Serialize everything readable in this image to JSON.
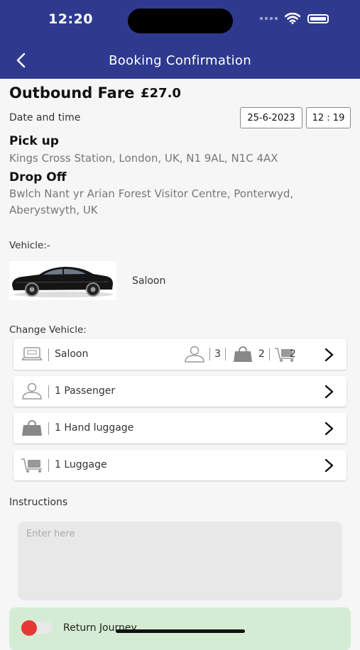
{
  "status_bar": {
    "time": "12:20"
  },
  "header": {
    "title": "Booking Confirmation"
  },
  "fare": {
    "label": "Outbound Fare",
    "value": "£27.0"
  },
  "datetime": {
    "label": "Date and time",
    "date": "25-6-2023",
    "time": "12 : 19"
  },
  "pickup": {
    "title": "Pick up",
    "address": "Kings Cross Station, London, UK, N1 9AL, N1C 4AX"
  },
  "dropoff": {
    "title": "Drop Off",
    "address": "Bwlch Nant yr Arian Forest Visitor Centre, Ponterwyd, Aberystwyth, UK"
  },
  "vehicle": {
    "label": "Vehicle:-",
    "name": "Saloon"
  },
  "change_vehicle": {
    "label": "Change Vehicle:",
    "rows": [
      {
        "label": "Saloon",
        "icon": "taxi-icon",
        "passengers": "3",
        "hand_luggage": "2",
        "luggage": "2"
      },
      {
        "label": "1 Passenger",
        "icon": "person-icon"
      },
      {
        "label": "1 Hand luggage",
        "icon": "bag-icon"
      },
      {
        "label": "1 Luggage",
        "icon": "luggage-trolley-icon"
      }
    ]
  },
  "instructions": {
    "label": "Instructions",
    "placeholder": "Enter here"
  },
  "return_journey": {
    "label": "Return Journey",
    "enabled": false
  },
  "colors": {
    "header": "#2f3a8f",
    "toggle_knob": "#e53935",
    "return_box": "#d4ecd4"
  }
}
